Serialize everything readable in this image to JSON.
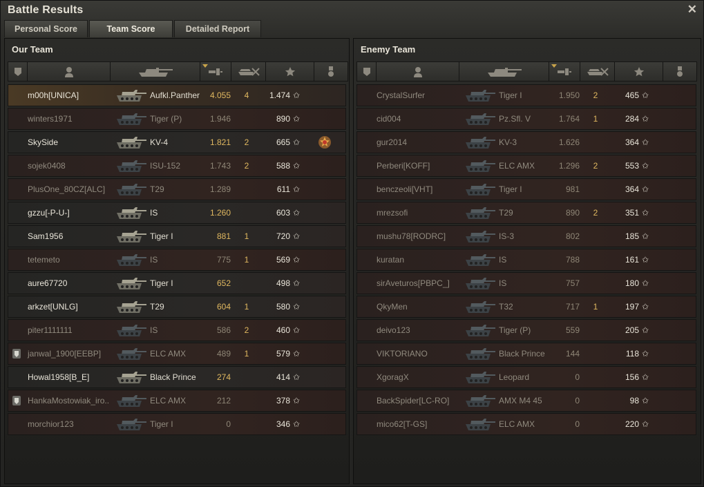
{
  "window": {
    "title": "Battle Results",
    "close_glyph": "✕"
  },
  "tabs": [
    {
      "label": "Personal Score"
    },
    {
      "label": "Team Score"
    },
    {
      "label": "Detailed Report"
    }
  ],
  "active_tab": 1,
  "header_icons": [
    "platoon-icon",
    "player-icon",
    "tank-icon",
    "damage-icon",
    "kills-icon",
    "xp-star-icon",
    "medal-icon"
  ],
  "our_team": {
    "title": "Our Team",
    "rows": [
      {
        "name": "m00h[UNICA]",
        "tank": "Aufkl.Panther",
        "damage": "4.055",
        "kills": "4",
        "xp": "1.474",
        "state": "self",
        "platoon": false,
        "medal": false
      },
      {
        "name": "winters1971",
        "tank": "Tiger (P)",
        "damage": "1.946",
        "kills": "",
        "xp": "890",
        "state": "dead",
        "platoon": false,
        "medal": false
      },
      {
        "name": "SkySide",
        "tank": "KV-4",
        "damage": "1.821",
        "kills": "2",
        "xp": "665",
        "state": "alive",
        "platoon": false,
        "medal": true
      },
      {
        "name": "sojek0408",
        "tank": "ISU-152",
        "damage": "1.743",
        "kills": "2",
        "xp": "588",
        "state": "dead",
        "platoon": false,
        "medal": false
      },
      {
        "name": "PlusOne_80CZ[ALC]",
        "tank": "T29",
        "damage": "1.289",
        "kills": "",
        "xp": "611",
        "state": "dead",
        "platoon": false,
        "medal": false
      },
      {
        "name": "gzzu[-P-U-]",
        "tank": "IS",
        "damage": "1.260",
        "kills": "",
        "xp": "603",
        "state": "alive",
        "platoon": false,
        "medal": false
      },
      {
        "name": "Sam1956",
        "tank": "Tiger I",
        "damage": "881",
        "kills": "1",
        "xp": "720",
        "state": "alive",
        "platoon": false,
        "medal": false
      },
      {
        "name": "tetemeto",
        "tank": "IS",
        "damage": "775",
        "kills": "1",
        "xp": "569",
        "state": "dead",
        "platoon": false,
        "medal": false
      },
      {
        "name": "aure67720",
        "tank": "Tiger I",
        "damage": "652",
        "kills": "",
        "xp": "498",
        "state": "alive",
        "platoon": false,
        "medal": false
      },
      {
        "name": "arkzet[UNLG]",
        "tank": "T29",
        "damage": "604",
        "kills": "1",
        "xp": "580",
        "state": "alive",
        "platoon": false,
        "medal": false
      },
      {
        "name": "piter1111111",
        "tank": "IS",
        "damage": "586",
        "kills": "2",
        "xp": "460",
        "state": "dead",
        "platoon": false,
        "medal": false
      },
      {
        "name": "janwal_1900[EEBP]",
        "tank": "ELC AMX",
        "damage": "489",
        "kills": "1",
        "xp": "579",
        "state": "dead",
        "platoon": true,
        "medal": false
      },
      {
        "name": "Howal1958[B_E]",
        "tank": "Black Prince",
        "damage": "274",
        "kills": "",
        "xp": "414",
        "state": "alive",
        "platoon": false,
        "medal": false
      },
      {
        "name": "HankaMostowiak_iro..",
        "tank": "ELC AMX",
        "damage": "212",
        "kills": "",
        "xp": "378",
        "state": "dead",
        "platoon": true,
        "medal": false
      },
      {
        "name": "morchior123",
        "tank": "Tiger I",
        "damage": "0",
        "kills": "",
        "xp": "346",
        "state": "dead",
        "platoon": false,
        "medal": false
      }
    ]
  },
  "enemy_team": {
    "title": "Enemy Team",
    "rows": [
      {
        "name": "CrystalSurfer",
        "tank": "Tiger I",
        "damage": "1.950",
        "kills": "2",
        "xp": "465",
        "state": "dead"
      },
      {
        "name": "cid004",
        "tank": "Pz.Sfl. V",
        "damage": "1.764",
        "kills": "1",
        "xp": "284",
        "state": "dead"
      },
      {
        "name": "gur2014",
        "tank": "KV-3",
        "damage": "1.626",
        "kills": "",
        "xp": "364",
        "state": "dead"
      },
      {
        "name": "Perberi[KOFF]",
        "tank": "ELC AMX",
        "damage": "1.296",
        "kills": "2",
        "xp": "553",
        "state": "dead"
      },
      {
        "name": "benczeoli[VHT]",
        "tank": "Tiger I",
        "damage": "981",
        "kills": "",
        "xp": "364",
        "state": "dead"
      },
      {
        "name": "mrezsofi",
        "tank": "T29",
        "damage": "890",
        "kills": "2",
        "xp": "351",
        "state": "dead"
      },
      {
        "name": "mushu78[RODRC]",
        "tank": "IS-3",
        "damage": "802",
        "kills": "",
        "xp": "185",
        "state": "dead"
      },
      {
        "name": "kuratan",
        "tank": "IS",
        "damage": "788",
        "kills": "",
        "xp": "161",
        "state": "dead"
      },
      {
        "name": "sirAveturos[PBPC_]",
        "tank": "IS",
        "damage": "757",
        "kills": "",
        "xp": "180",
        "state": "dead"
      },
      {
        "name": "QkyMen",
        "tank": "T32",
        "damage": "717",
        "kills": "1",
        "xp": "197",
        "state": "dead"
      },
      {
        "name": "deivo123",
        "tank": "Tiger (P)",
        "damage": "559",
        "kills": "",
        "xp": "205",
        "state": "dead"
      },
      {
        "name": "VIKTORIANO",
        "tank": "Black Prince",
        "damage": "144",
        "kills": "",
        "xp": "118",
        "state": "dead"
      },
      {
        "name": "XgoragX",
        "tank": "Leopard",
        "damage": "0",
        "kills": "",
        "xp": "156",
        "state": "dead"
      },
      {
        "name": "BackSpider[LC-RO]",
        "tank": "AMX M4 45",
        "damage": "0",
        "kills": "",
        "xp": "98",
        "state": "dead"
      },
      {
        "name": "mico62[T-GS]",
        "tank": "ELC AMX",
        "damage": "0",
        "kills": "",
        "xp": "220",
        "state": "dead"
      }
    ]
  },
  "star_glyph": "✩",
  "colors": {
    "damage_alive": "#e0b860",
    "kills": "#e0b860",
    "self_row": "#4a3a25",
    "dead_row": "#2c201d"
  }
}
